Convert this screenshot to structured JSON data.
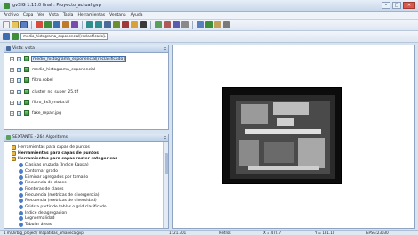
{
  "window": {
    "title": "gvSIG 1.11.0 final : Proyecto_actual.gvp",
    "minimize": "–",
    "maximize": "□",
    "close": "✕"
  },
  "menubar": {
    "items": [
      "Archivo",
      "Capa",
      "Ver",
      "Vista",
      "Tabla",
      "Herramientas",
      "Ventana",
      "Ayuda"
    ]
  },
  "toolbar": {
    "layer_combo": "medio_histograma_exponencial[reclasificado]",
    "combo_arrow": "▾"
  },
  "toc": {
    "title": "Vista: vista",
    "close": "x",
    "layers": [
      {
        "label": "medio_histograma_exponencial[reclasificado]",
        "checked": true,
        "selected": true
      },
      {
        "label": "medio_histograma_exponencial",
        "checked": true,
        "selected": false
      },
      {
        "label": "filtro.sobel",
        "checked": true,
        "selected": false
      },
      {
        "label": "cluster_no_super_25.tif",
        "checked": true,
        "selected": false
      },
      {
        "label": "filtro_3x3_moda.tif",
        "checked": true,
        "selected": false
      },
      {
        "label": "fake_repair.jpg",
        "checked": true,
        "selected": false
      }
    ]
  },
  "sextante": {
    "title": "SEXTANTE - 264 Algorithms",
    "close": "x",
    "items": [
      {
        "label": "Herramientas para capas de puntos",
        "level": 1,
        "bold": false,
        "folder": true
      },
      {
        "label": "Herramientas para capas de puntos",
        "level": 1,
        "bold": true,
        "folder": true
      },
      {
        "label": "Herramientas para capas raster categoricas",
        "level": 1,
        "bold": true,
        "folder": true
      },
      {
        "label": "Clasicas cruzada (Indice Kappa)",
        "level": 2,
        "bold": false,
        "folder": false
      },
      {
        "label": "Contornar grado",
        "level": 2,
        "bold": false,
        "folder": false
      },
      {
        "label": "Eliminar agregados por tamaño",
        "level": 2,
        "bold": false,
        "folder": false
      },
      {
        "label": "Frecuencia de clases",
        "level": 2,
        "bold": false,
        "folder": false
      },
      {
        "label": "Fronteras de clases",
        "level": 2,
        "bold": false,
        "folder": false
      },
      {
        "label": "Frecuencia (metricas de divergencia)",
        "level": 2,
        "bold": false,
        "folder": false
      },
      {
        "label": "Frecuencia (metricas de diversidad)",
        "level": 2,
        "bold": false,
        "folder": false
      },
      {
        "label": "Grids a partir de tablas o grid clasificado",
        "level": 2,
        "bold": false,
        "folder": false
      },
      {
        "label": "Indice de agregacion",
        "level": 2,
        "bold": false,
        "folder": false
      },
      {
        "label": "Lognormalidad",
        "level": 2,
        "bold": false,
        "folder": false
      },
      {
        "label": "Tabular áreas",
        "level": 2,
        "bold": false,
        "folder": false
      }
    ]
  },
  "statusbar": {
    "path": "1 m/Dirbig_project/ mapatidas_amaneca.gvp",
    "scale": "1: 21.301",
    "units": "Metros",
    "x": "X = 470.7",
    "y": "Y = 181.10",
    "epsg": "EPSG:23030"
  }
}
